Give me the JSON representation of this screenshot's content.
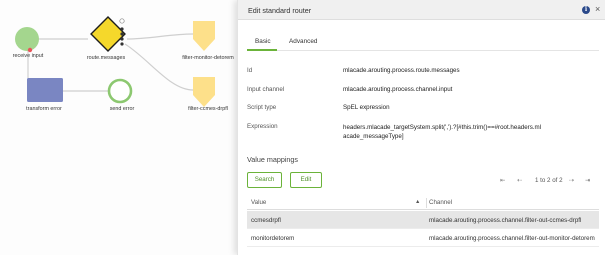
{
  "canvas": {
    "nodes": {
      "receive_input": "receive input",
      "route_messages": "route.messages",
      "filter_monitor": "filter-monitor-detorem",
      "transform_error": "transform error",
      "send_error": "send error",
      "filter_ccmes": "filter-ccmes-drpfl"
    },
    "colors": {
      "start": "#a4d68e",
      "router": "#f5d82b",
      "filter": "#fde08a",
      "transformer": "#7a86c2",
      "end_ring": "#8cc870"
    }
  },
  "panel": {
    "title": "Edit standard router",
    "info_glyph": "i",
    "close_glyph": "×",
    "tabs": [
      {
        "label": "Basic",
        "active": true
      },
      {
        "label": "Advanced",
        "active": false
      }
    ],
    "properties": {
      "id_label": "Id",
      "id_value": "mlacade.arouting.process.route.messages",
      "input_channel_label": "Input channel",
      "input_channel_value": "mlacade.arouting.process.channel.input",
      "script_type_label": "Script type",
      "script_type_value": "SpEL expression",
      "expression_label": "Expression",
      "expression_value": "headers.mlacade_targetSystem.split(',').?[#this.trim()==#root.headers.mlacade_messageType]"
    },
    "value_mappings": {
      "title": "Value mappings",
      "search_label": "Search",
      "edit_label": "Edit",
      "pagination": {
        "first": "⇤",
        "prev": "⇠",
        "text": "1 to 2 of 2",
        "next": "⇢",
        "last": "⇥"
      },
      "columns": {
        "value": "Value",
        "sort_glyph": "▲",
        "channel": "Channel"
      },
      "rows": [
        {
          "value": "ccmesdrpfl",
          "channel": "mlacade.arouting.process.channel.filter-out-ccmes-drpfl",
          "selected": true
        },
        {
          "value": "monitordetorem",
          "channel": "mlacade.arouting.process.channel.filter-out-monitor-detorem",
          "selected": false
        }
      ]
    }
  }
}
